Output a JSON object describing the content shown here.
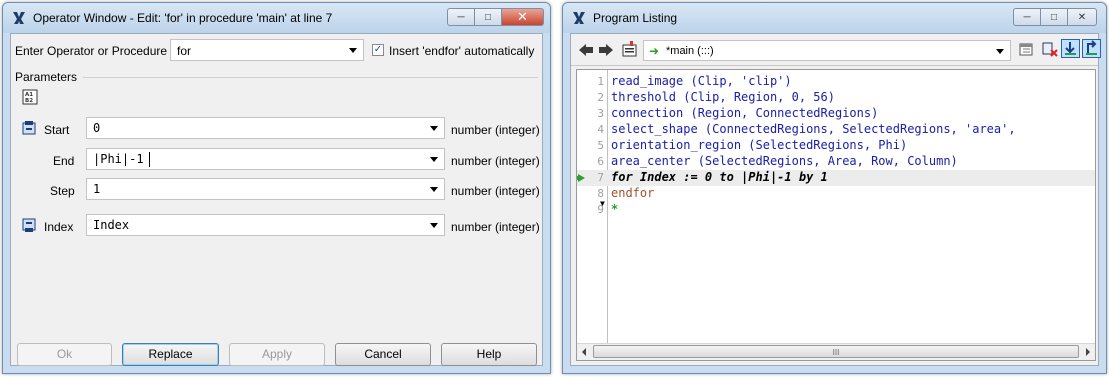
{
  "operator_window": {
    "title": "Operator Window - Edit: 'for' in procedure 'main' at line 7",
    "operator_label": "Enter Operator or Procedure",
    "operator_value": "for",
    "insert_endfor_checked": true,
    "insert_endfor_label": "Insert 'endfor'  automatically",
    "parameters_label": "Parameters",
    "params": [
      {
        "name": "Start",
        "value": "0",
        "type": "number (integer)",
        "icon": "input-parameter-icon"
      },
      {
        "name": "End",
        "value": "|Phi|-1",
        "type": "number (integer)",
        "icon": ""
      },
      {
        "name": "Step",
        "value": "1",
        "type": "number (integer)",
        "icon": ""
      },
      {
        "name": "Index",
        "value": "Index",
        "type": "number (integer)",
        "icon": "output-parameter-icon"
      }
    ],
    "buttons": {
      "ok": "Ok",
      "replace": "Replace",
      "apply": "Apply",
      "cancel": "Cancel",
      "help": "Help"
    }
  },
  "program_listing": {
    "title": "Program Listing",
    "procedure_value": "*main (:::)",
    "current_line": 7,
    "lines": [
      {
        "num": "1",
        "text": "read_image (Clip, 'clip')"
      },
      {
        "num": "2",
        "text": "threshold (Clip, Region, 0, 56)"
      },
      {
        "num": "3",
        "text": "connection (Region, ConnectedRegions)"
      },
      {
        "num": "4",
        "text": "select_shape (ConnectedRegions, SelectedRegions, 'area',"
      },
      {
        "num": "5",
        "text": "orientation_region (SelectedRegions, Phi)"
      },
      {
        "num": "6",
        "text": "area_center (SelectedRegions, Area, Row, Column)"
      },
      {
        "num": "7",
        "text": "for Index := 0 to |Phi|-1 by 1"
      },
      {
        "num": "8",
        "text": "endfor"
      },
      {
        "num": "9",
        "text": "*"
      }
    ],
    "scrollbar_grip": "III"
  },
  "colors": {
    "code_text": "#1b20a8",
    "endfor_text": "#a0522d",
    "pc_arrow": "#2aa12d",
    "close_button": "#c9462c"
  }
}
